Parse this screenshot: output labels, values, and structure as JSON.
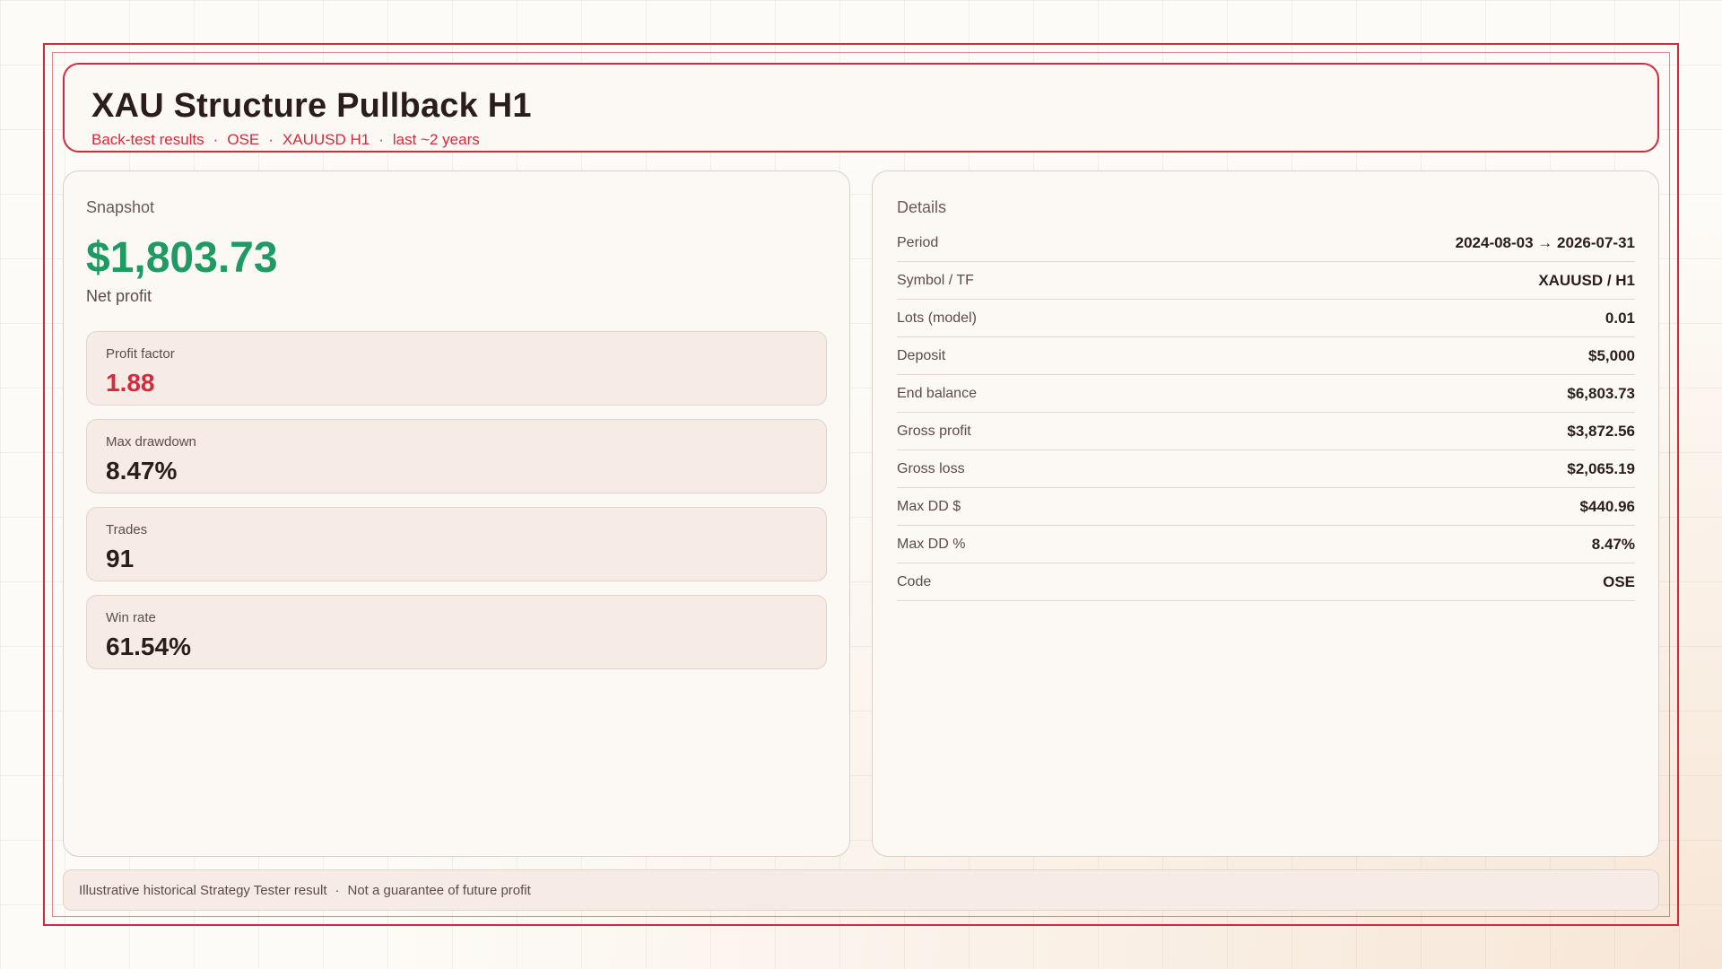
{
  "header": {
    "title": "XAU Structure Pullback H1",
    "subtitle_parts": [
      "Back-test results",
      "OSE",
      "XAUUSD H1",
      "last ~2 years"
    ],
    "separator": "·"
  },
  "snapshot": {
    "label": "Snapshot",
    "net_profit_value": "$1,803.73",
    "net_profit_label": "Net profit",
    "stats": [
      {
        "label": "Profit factor",
        "value": "1.88"
      },
      {
        "label": "Max drawdown",
        "value": "8.47%"
      },
      {
        "label": "Trades",
        "value": "91"
      },
      {
        "label": "Win rate",
        "value": "61.54%"
      }
    ]
  },
  "details": {
    "label": "Details",
    "rows": [
      {
        "key": "Period",
        "value": "2024-08-03 → 2026-07-31"
      },
      {
        "key": "Symbol / TF",
        "value": "XAUUSD / H1"
      },
      {
        "key": "Lots (model)",
        "value": "0.01"
      },
      {
        "key": "Deposit",
        "value": "$5,000"
      },
      {
        "key": "End balance",
        "value": "$6,803.73"
      },
      {
        "key": "Gross profit",
        "value": "$3,872.56"
      },
      {
        "key": "Gross loss",
        "value": "$2,065.19"
      },
      {
        "key": "Max DD $",
        "value": "$440.96"
      },
      {
        "key": "Max DD %",
        "value": "8.47%"
      },
      {
        "key": "Code",
        "value": "OSE"
      }
    ]
  },
  "footer": {
    "left": "Illustrative historical Strategy Tester result",
    "separator": "·",
    "right": "Not a guarantee of future profit"
  },
  "colors": {
    "accent": "#d42a3c",
    "profit": "#1f9a62"
  }
}
